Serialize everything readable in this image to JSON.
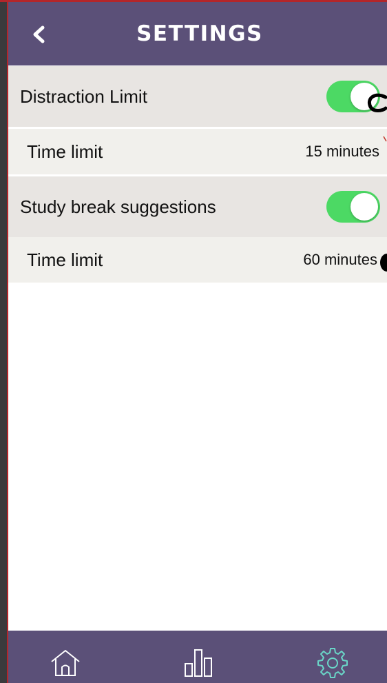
{
  "header": {
    "back_label": "<",
    "title": "SETTINGS"
  },
  "settings": [
    {
      "label": "Distraction Limit",
      "enabled": true,
      "sub_label": "Time limit",
      "sub_value": "15 minutes"
    },
    {
      "label": "Study break suggestions",
      "enabled": true,
      "sub_label": "Time limit",
      "sub_value": "60 minutes"
    }
  ],
  "tabbar": {
    "tabs": [
      {
        "icon": "home-icon"
      },
      {
        "icon": "bar-chart-icon"
      },
      {
        "icon": "gear-icon"
      }
    ]
  },
  "colors": {
    "header_bg": "#5b5078",
    "toggle_on": "#4cd964",
    "row_bg": "#e8e5e2",
    "subrow_bg": "#f1f0ec"
  }
}
